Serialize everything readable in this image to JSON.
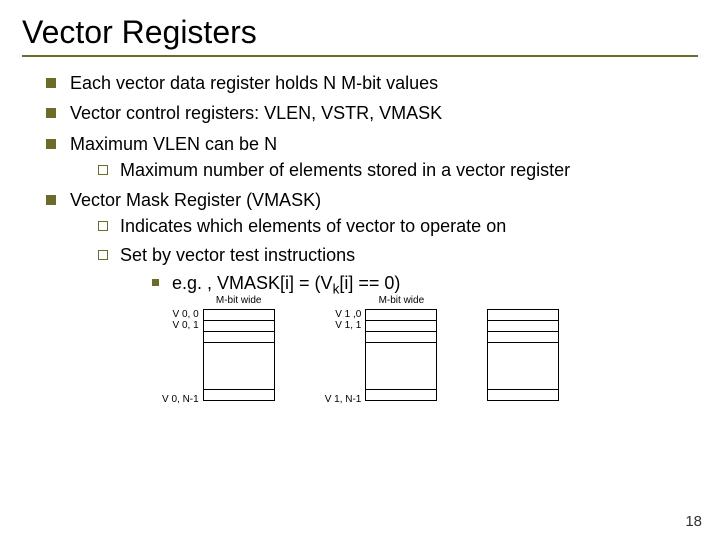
{
  "title": "Vector Registers",
  "bullets": {
    "b1": "Each vector data register holds N M-bit values",
    "b2": "Vector control registers: VLEN, VSTR, VMASK",
    "b3": "Maximum VLEN can be N",
    "b3a": "Maximum number of elements stored in a vector register",
    "b4": "Vector Mask Register (VMASK)",
    "b4a": "Indicates which elements of vector to operate on",
    "b4b": "Set by vector test instructions",
    "b4b1_pre": "e.g. , VMASK[i] = (V",
    "b4b1_sub": "k",
    "b4b1_post": "[i] == 0)"
  },
  "diagram": {
    "width_label": "M-bit wide",
    "v0_0": "V 0, 0",
    "v0_1": "V 0, 1",
    "v0_n": "V 0, N-1",
    "v1_0": "V 1 ,0",
    "v1_1": "V 1, 1",
    "v1_n": "V 1, N-1"
  },
  "page": "18"
}
